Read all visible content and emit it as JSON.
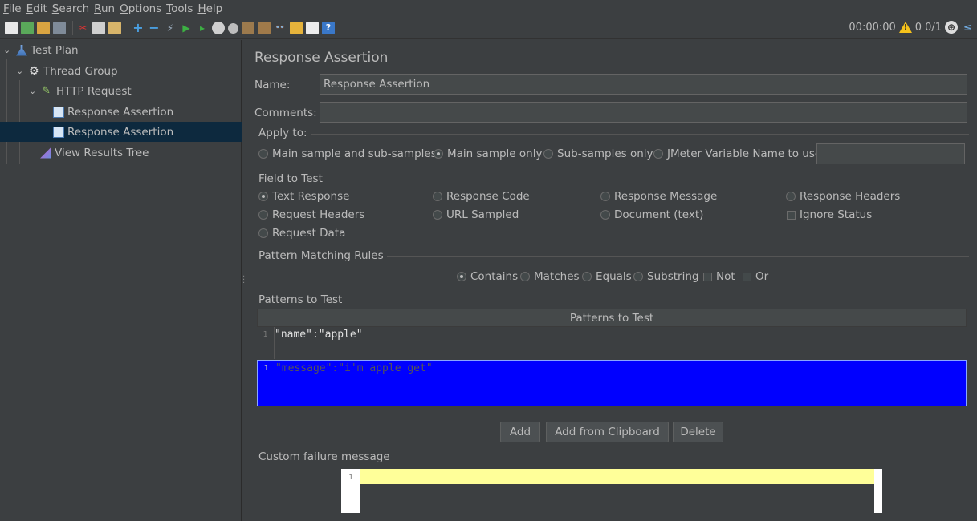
{
  "menu": [
    {
      "first": "F",
      "rest": "ile"
    },
    {
      "first": "E",
      "rest": "dit"
    },
    {
      "first": "S",
      "rest": "earch"
    },
    {
      "first": "R",
      "rest": "un"
    },
    {
      "first": "O",
      "rest": "ptions"
    },
    {
      "first": "T",
      "rest": "ools"
    },
    {
      "first": "H",
      "rest": "elp"
    }
  ],
  "toolbar": {
    "timer": "00:00:00",
    "warnings": "0",
    "threads": "0/1"
  },
  "tree": {
    "items": [
      {
        "label": "Test Plan"
      },
      {
        "label": "Thread Group"
      },
      {
        "label": "HTTP Request"
      },
      {
        "label": "Response Assertion"
      },
      {
        "label": "Response Assertion"
      },
      {
        "label": "View Results Tree"
      }
    ]
  },
  "panel": {
    "title": "Response Assertion",
    "name_label": "Name:",
    "name_value": "Response Assertion",
    "comments_label": "Comments:",
    "comments_value": "",
    "apply_to": {
      "title": "Apply to:",
      "options": [
        "Main sample and sub-samples",
        "Main sample only",
        "Sub-samples only",
        "JMeter Variable Name to use"
      ],
      "selected": "Main sample only",
      "variable_value": ""
    },
    "field_to_test": {
      "title": "Field to Test",
      "options": [
        "Text Response",
        "Response Code",
        "Response Message",
        "Response Headers",
        "Request Headers",
        "URL Sampled",
        "Document (text)",
        "Ignore Status",
        "Request Data"
      ],
      "selected": "Text Response"
    },
    "pattern_rules": {
      "title": "Pattern Matching Rules",
      "options": [
        "Contains",
        "Matches",
        "Equals",
        "Substring",
        "Not",
        "Or"
      ],
      "selected": "Contains"
    },
    "patterns": {
      "title": "Patterns to Test",
      "column_header": "Patterns to Test",
      "rows": [
        {
          "line": "1",
          "text": "\"name\":\"apple\""
        },
        {
          "line": "1",
          "text": "\"message\":\"i'm apple get\""
        }
      ],
      "selected_row_color": "#0000ff"
    },
    "buttons": {
      "add": "Add",
      "add_clipboard": "Add from Clipboard",
      "delete": "Delete"
    },
    "failure": {
      "title": "Custom failure message",
      "line": "1",
      "highlight_color": "#ffff99"
    }
  }
}
